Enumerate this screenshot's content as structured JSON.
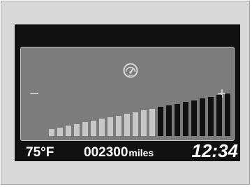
{
  "display": {
    "temperature": {
      "value": "75",
      "unit": "°F"
    },
    "odometer": {
      "value": "002300",
      "unit": "miles"
    },
    "clock": "12:34"
  },
  "gauge": {
    "icon": "speedometer-icon",
    "decrease_label": "−",
    "increase_label": "+",
    "total_segments": 22,
    "lit_segments": 13,
    "colors": {
      "lit": "#c8c8c8",
      "unlit": "#111111",
      "panel": "#7c7c7c",
      "screen": "#111111"
    }
  }
}
